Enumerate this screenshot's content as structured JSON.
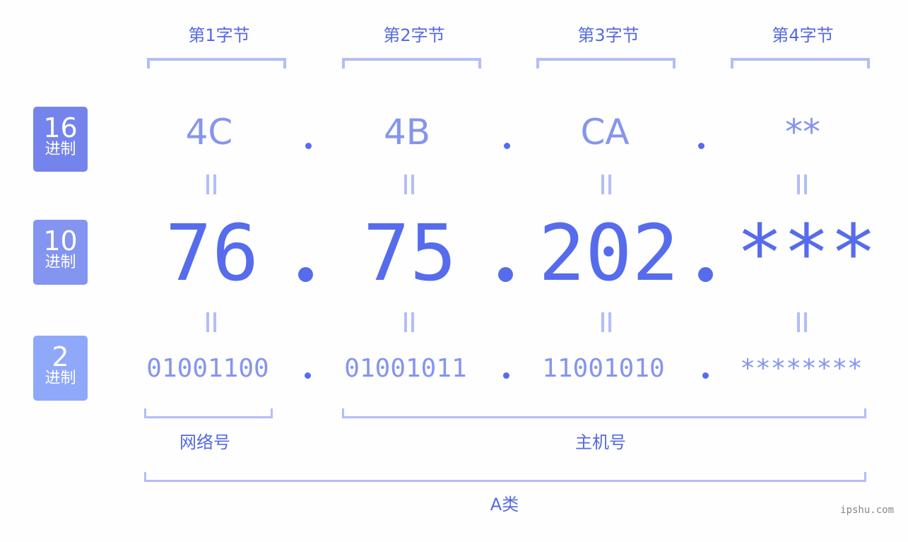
{
  "badges": [
    {
      "number": "16",
      "unit": "进制",
      "color": "#7584ec"
    },
    {
      "number": "10",
      "unit": "进制",
      "color": "#8394f1"
    },
    {
      "number": "2",
      "unit": "进制",
      "color": "#8fa8f9"
    }
  ],
  "bytes": [
    {
      "label": "第1字节",
      "hex": "4C",
      "dec": "76",
      "bin": "01001100"
    },
    {
      "label": "第2字节",
      "hex": "4B",
      "dec": "75",
      "bin": "01001011"
    },
    {
      "label": "第3字节",
      "hex": "CA",
      "dec": "202",
      "bin": "11001010"
    },
    {
      "label": "第4字节",
      "hex": "**",
      "dec": "***",
      "bin": "********"
    }
  ],
  "sections": {
    "network": "网络号",
    "host": "主机号",
    "class": "A类"
  },
  "watermark": "ipshu.com",
  "colors": {
    "accent": "#566ced",
    "light": "#8595ee",
    "bracket": "#b3bdf7"
  }
}
